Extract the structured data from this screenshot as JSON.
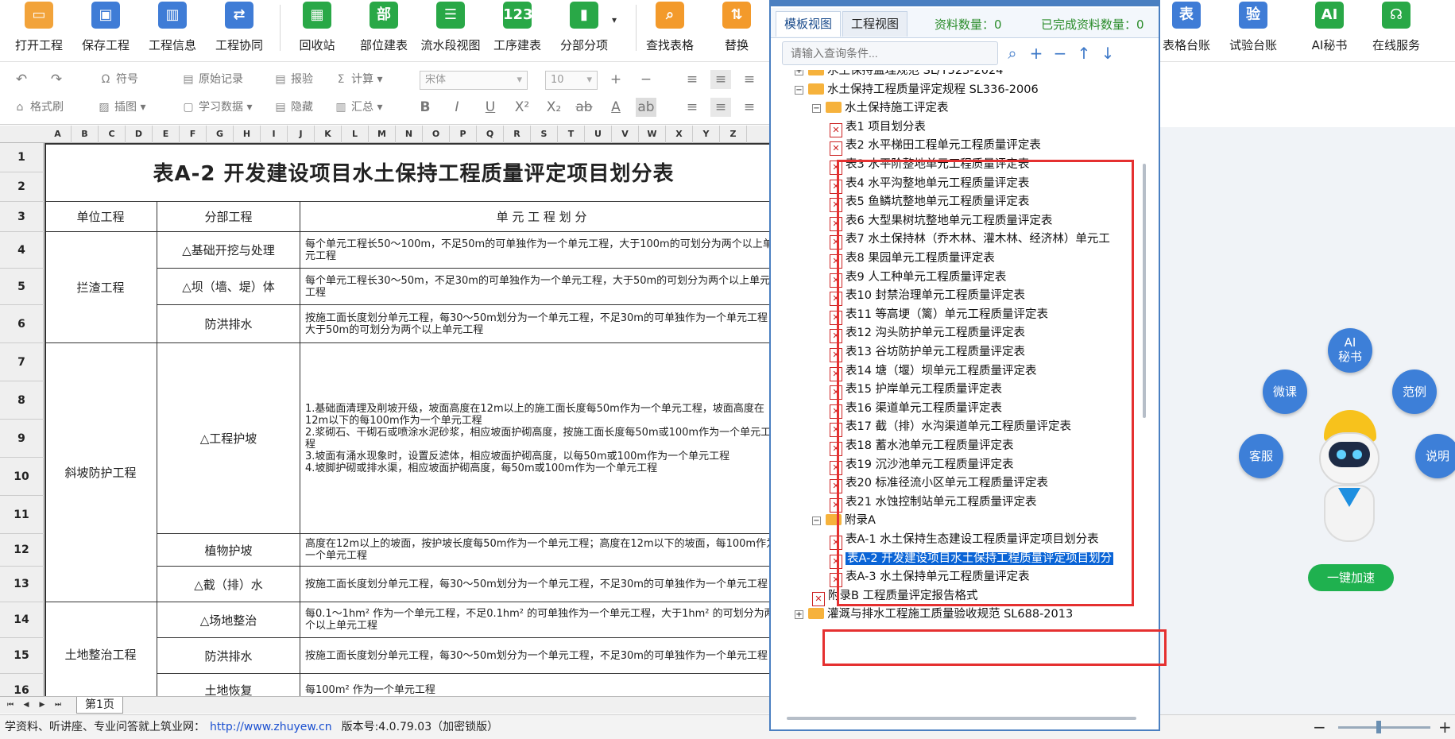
{
  "ribbon": {
    "left_buttons": [
      {
        "label": "打开工程",
        "icon": "folder-open-icon",
        "color": "#f2a33a",
        "glyph": "▭"
      },
      {
        "label": "保存工程",
        "icon": "save-icon",
        "color": "#3f7cd6",
        "glyph": "▣"
      },
      {
        "label": "工程信息",
        "icon": "building-icon",
        "color": "#3f7cd6",
        "glyph": "▥"
      },
      {
        "label": "工程协同",
        "icon": "handshake-icon",
        "color": "#3f7cd6",
        "glyph": "⇄"
      },
      {
        "label": "回收站",
        "icon": "trash-icon",
        "color": "#29a847",
        "glyph": "▦"
      },
      {
        "label": "部位建表",
        "icon": "table-part-icon",
        "color": "#29a847",
        "glyph": "部"
      },
      {
        "label": "流水段视图",
        "icon": "list-view-icon",
        "color": "#29a847",
        "glyph": "☰"
      },
      {
        "label": "工序建表",
        "icon": "sequence-table-icon",
        "color": "#29a847",
        "glyph": "123"
      },
      {
        "label": "分部分项",
        "icon": "bar-chart-icon",
        "color": "#29a847",
        "glyph": "▮"
      },
      {
        "label": "查找表格",
        "icon": "search-table-icon",
        "color": "#f39a2b",
        "glyph": "⌕"
      },
      {
        "label": "替换",
        "icon": "replace-icon",
        "color": "#f39a2b",
        "glyph": "⇅"
      }
    ],
    "right_buttons": [
      {
        "label": "表格台账",
        "icon": "table-ledger-icon",
        "color": "#3f7cd6",
        "glyph": "表"
      },
      {
        "label": "试验台账",
        "icon": "test-ledger-icon",
        "color": "#3f7cd6",
        "glyph": "验"
      },
      {
        "label": "AI秘书",
        "icon": "ai-icon",
        "color": "#29a847",
        "glyph": "AI"
      },
      {
        "label": "在线服务",
        "icon": "headset-icon",
        "color": "#29a847",
        "glyph": "☊"
      }
    ],
    "row2": {
      "symbol": "符号",
      "original_record": "原始记录",
      "report": "报验",
      "calculate": "计算",
      "format_brush": "格式刷",
      "insert_image": "插图",
      "study_data": "学习数据",
      "hide": "隐藏",
      "summary": "汇总",
      "font": "宋体",
      "font_size": "10"
    }
  },
  "sheet": {
    "columns": [
      "A",
      "B",
      "C",
      "D",
      "E",
      "F",
      "G",
      "H",
      "I",
      "J",
      "K",
      "L",
      "M",
      "N",
      "O",
      "P",
      "Q",
      "R",
      "S",
      "T",
      "U",
      "V",
      "W",
      "X",
      "Y",
      "Z"
    ],
    "rows": [
      "1",
      "2",
      "3",
      "4",
      "5",
      "6",
      "7",
      "8",
      "9",
      "10",
      "11",
      "12",
      "13",
      "14",
      "15",
      "16"
    ],
    "title": "表A-2 开发建设项目水土保持工程质量评定项目划分表",
    "headers": {
      "unit": "单位工程",
      "division": "分部工程",
      "partition": "单 元 工 程 划 分"
    },
    "units": [
      "拦渣工程",
      "斜坡防护工程",
      "土地整治工程"
    ],
    "divisions": [
      "△基础开挖与处理",
      "△坝（墙、堤）体",
      "防洪排水",
      "△工程护坡",
      "植物护坡",
      "△截（排）水",
      "△场地整治",
      "防洪排水",
      "土地恢复"
    ],
    "partitions": [
      "每个单元工程长50～100m，不足50m的可单独作为一个单元工程，大于100m的可划分为两个以上单元工程",
      "每个单元工程长30～50m，不足30m的可单独作为一个单元工程，大于50m的可划分为两个以上单元工程",
      "按施工面长度划分单元工程，每30～50m划分为一个单元工程，不足30m的可单独作为一个单元工程，大于50m的可划分为两个以上单元工程",
      "1.基础面清理及削坡开级，坡面高度在12m以上的施工面长度每50m作为一个单元工程，坡面高度在12m以下的每100m作为一个单元工程\n2.浆砌石、干砌石或喷涂水泥砂浆，相应坡面护砌高度，按施工面长度每50m或100m作为一个单元工程\n3.坡面有涌水现象时，设置反滤体，相应坡面护砌高度，以每50m或100m作为一个单元工程\n4.坡脚护砌或排水渠，相应坡面护砌高度，每50m或100m作为一个单元工程",
      "高度在12m以上的坡面，按护坡长度每50m作为一个单元工程；高度在12m以下的坡面，每100m作为一个单元工程",
      "按施工面长度划分单元工程，每30～50m划分为一个单元工程，不足30m的可单独作为一个单元工程",
      "每0.1～1hm² 作为一个单元工程，不足0.1hm² 的可单独作为一个单元工程，大于1hm² 的可划分为两个以上单元工程",
      "按施工面长度划分单元工程，每30～50m划分为一个单元工程，不足30m的可单独作为一个单元工程",
      "每100m² 作为一个单元工程"
    ],
    "sheet_tab": "第1页"
  },
  "status": {
    "text": "学资料、听讲座、专业问答就上筑业网：",
    "url": "http://www.zhuyew.cn",
    "version": "版本号:4.0.79.03（加密锁版）"
  },
  "panel": {
    "tab_template": "模板视图",
    "tab_project": "工程视图",
    "data_count_label": "资料数量：0",
    "done_count_label": "已完成资料数量：0",
    "search_placeholder": "请输入查询条件...",
    "tree": [
      {
        "label": "水土保持监理规范 SL/T523-2024",
        "type": "folder",
        "indent": 0,
        "expand": "+"
      },
      {
        "label": "水土保持工程质量评定规程 SL336-2006",
        "type": "folder",
        "indent": 0,
        "expand": "−"
      },
      {
        "label": "水土保持施工评定表",
        "type": "folder",
        "indent": 1,
        "expand": "−"
      },
      {
        "label": "表1 项目划分表",
        "type": "doc",
        "indent": 2
      },
      {
        "label": "表2 水平梯田工程单元工程质量评定表",
        "type": "doc",
        "indent": 2
      },
      {
        "label": "表3 水平阶整地单元工程质量评定表",
        "type": "doc",
        "indent": 2
      },
      {
        "label": "表4 水平沟整地单元工程质量评定表",
        "type": "doc",
        "indent": 2
      },
      {
        "label": "表5 鱼鳞坑整地单元工程质量评定表",
        "type": "doc",
        "indent": 2
      },
      {
        "label": "表6 大型果树坑整地单元工程质量评定表",
        "type": "doc",
        "indent": 2
      },
      {
        "label": "表7 水土保持林（乔木林、灌木林、经济林）单元工",
        "type": "doc",
        "indent": 2
      },
      {
        "label": "表8 果园单元工程质量评定表",
        "type": "doc",
        "indent": 2
      },
      {
        "label": "表9 人工种单元工程质量评定表",
        "type": "doc",
        "indent": 2
      },
      {
        "label": "表10 封禁治理单元工程质量评定表",
        "type": "doc",
        "indent": 2
      },
      {
        "label": "表11 等高埂（篱）单元工程质量评定表",
        "type": "doc",
        "indent": 2
      },
      {
        "label": "表12 沟头防护单元工程质量评定表",
        "type": "doc",
        "indent": 2
      },
      {
        "label": "表13 谷坊防护单元工程质量评定表",
        "type": "doc",
        "indent": 2
      },
      {
        "label": "表14 塘（堰）坝单元工程质量评定表",
        "type": "doc",
        "indent": 2
      },
      {
        "label": "表15 护岸单元工程质量评定表",
        "type": "doc",
        "indent": 2
      },
      {
        "label": "表16 渠道单元工程质量评定表",
        "type": "doc",
        "indent": 2
      },
      {
        "label": "表17 截（排）水沟渠道单元工程质量评定表",
        "type": "doc",
        "indent": 2
      },
      {
        "label": "表18 蓄水池单元工程质量评定表",
        "type": "doc",
        "indent": 2
      },
      {
        "label": "表19 沉沙池单元工程质量评定表",
        "type": "doc",
        "indent": 2
      },
      {
        "label": "表20 标准径流小区单元工程质量评定表",
        "type": "doc",
        "indent": 2
      },
      {
        "label": "表21 水蚀控制站单元工程质量评定表",
        "type": "doc",
        "indent": 2
      },
      {
        "label": "附录A",
        "type": "folder",
        "indent": 1,
        "expand": "−"
      },
      {
        "label": "表A-1 水土保持生态建设工程质量评定项目划分表",
        "type": "doc",
        "indent": 2
      },
      {
        "label": "表A-2 开发建设项目水土保持工程质量评定项目划分",
        "type": "doc",
        "indent": 2,
        "selected": true
      },
      {
        "label": "表A-3 水土保持单元工程质量评定表",
        "type": "doc",
        "indent": 2
      },
      {
        "label": "附录B 工程质量评定报告格式",
        "type": "doc",
        "indent": 1
      },
      {
        "label": "灌溉与排水工程施工质量验收规范 SL688-2013",
        "type": "folder",
        "indent": 0,
        "expand": "+"
      }
    ]
  },
  "assistant": {
    "ai": "AI\n秘书",
    "micro_course": "微课",
    "example": "范例",
    "service": "客服",
    "manual": "说明",
    "accelerate": "一键加速"
  },
  "colors": {
    "accent": "#3f7cd6",
    "highlight_red": "#e53030",
    "selection": "#0a64d6",
    "green": "#29a847"
  }
}
